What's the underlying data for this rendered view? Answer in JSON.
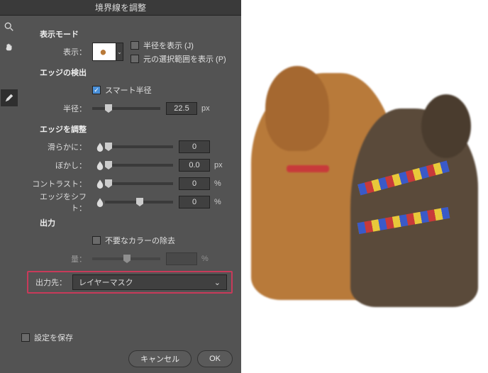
{
  "title": "境界線を調整",
  "sections": {
    "view_mode": "表示モード",
    "edge_detect": "エッジの検出",
    "edge_adjust": "エッジを調整",
    "output": "出力"
  },
  "view": {
    "show_label": "表示：",
    "show_radius": "半径を表示 (J)",
    "show_original": "元の選択範囲を表示 (P)"
  },
  "edge_detect": {
    "smart_radius": "スマート半径",
    "radius_label": "半径：",
    "radius_value": "22.5",
    "radius_unit": "px"
  },
  "edge_adjust": {
    "smooth_label": "滑らかに：",
    "smooth_value": "0",
    "feather_label": "ぼかし：",
    "feather_value": "0.0",
    "feather_unit": "px",
    "contrast_label": "コントラスト：",
    "contrast_value": "0",
    "contrast_unit": "%",
    "shift_label": "エッジをシフト：",
    "shift_value": "0",
    "shift_unit": "%"
  },
  "output": {
    "decontaminate": "不要なカラーの除去",
    "amount_label": "量：",
    "output_to_label": "出力先：",
    "output_to_value": "レイヤーマスク"
  },
  "save_settings": "設定を保存",
  "buttons": {
    "cancel": "キャンセル",
    "ok": "OK"
  }
}
